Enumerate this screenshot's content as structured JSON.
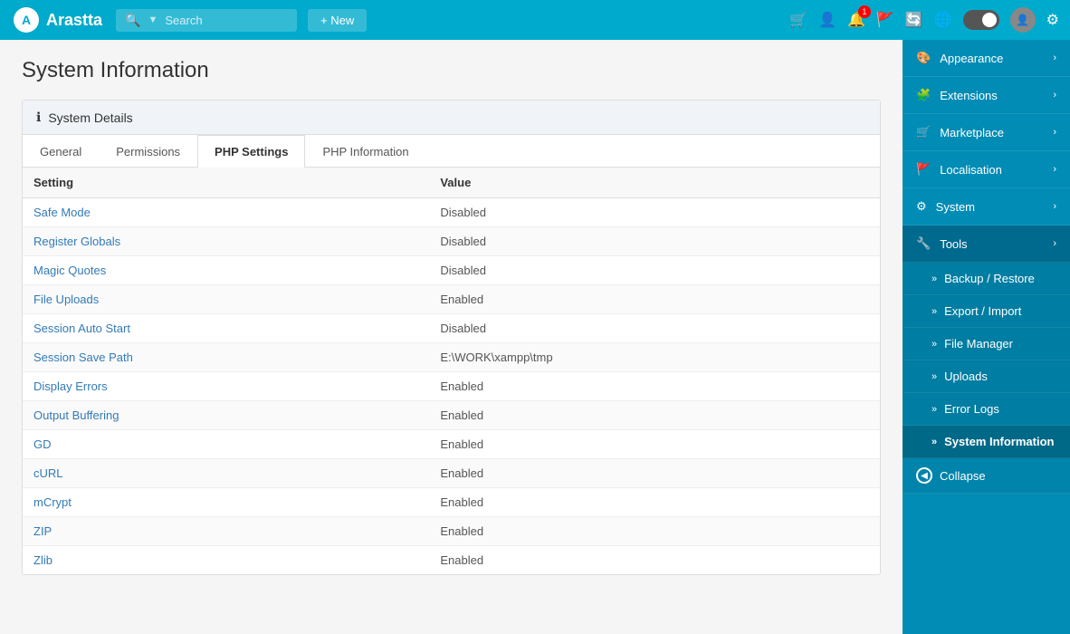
{
  "app": {
    "brand": "Arastta",
    "logo_letter": "A"
  },
  "navbar": {
    "search_placeholder": "Search",
    "new_label": "+ New",
    "notification_count": "1"
  },
  "page": {
    "title": "System Information"
  },
  "card": {
    "header": "System Details"
  },
  "tabs": [
    {
      "label": "General",
      "active": false
    },
    {
      "label": "Permissions",
      "active": false
    },
    {
      "label": "PHP Settings",
      "active": true
    },
    {
      "label": "PHP Information",
      "active": false
    }
  ],
  "table": {
    "col_setting": "Setting",
    "col_value": "Value",
    "rows": [
      {
        "setting": "Safe Mode",
        "value": "Disabled"
      },
      {
        "setting": "Register Globals",
        "value": "Disabled"
      },
      {
        "setting": "Magic Quotes",
        "value": "Disabled"
      },
      {
        "setting": "File Uploads",
        "value": "Enabled"
      },
      {
        "setting": "Session Auto Start",
        "value": "Disabled"
      },
      {
        "setting": "Session Save Path",
        "value": "E:\\WORK\\xampp\\tmp"
      },
      {
        "setting": "Display Errors",
        "value": "Enabled"
      },
      {
        "setting": "Output Buffering",
        "value": "Enabled"
      },
      {
        "setting": "GD",
        "value": "Enabled"
      },
      {
        "setting": "cURL",
        "value": "Enabled"
      },
      {
        "setting": "mCrypt",
        "value": "Enabled"
      },
      {
        "setting": "ZIP",
        "value": "Enabled"
      },
      {
        "setting": "Zlib",
        "value": "Enabled"
      }
    ]
  },
  "sidebar": {
    "items": [
      {
        "id": "appearance",
        "label": "Appearance",
        "icon": "🎨",
        "has_chevron": true
      },
      {
        "id": "extensions",
        "label": "Extensions",
        "icon": "🧩",
        "has_chevron": true
      },
      {
        "id": "marketplace",
        "label": "Marketplace",
        "icon": "🛒",
        "has_chevron": true
      },
      {
        "id": "localisation",
        "label": "Localisation",
        "icon": "🚩",
        "has_chevron": true
      },
      {
        "id": "system",
        "label": "System",
        "icon": "⚙",
        "has_chevron": true
      },
      {
        "id": "tools",
        "label": "Tools",
        "icon": "🔧",
        "active": true,
        "has_chevron": true
      }
    ],
    "sub_items": [
      {
        "id": "backup-restore",
        "label": "Backup / Restore"
      },
      {
        "id": "export-import",
        "label": "Export / Import"
      },
      {
        "id": "file-manager",
        "label": "File Manager"
      },
      {
        "id": "uploads",
        "label": "Uploads"
      },
      {
        "id": "error-logs",
        "label": "Error Logs"
      },
      {
        "id": "system-information",
        "label": "System Information",
        "active": true
      }
    ],
    "collapse_label": "Collapse"
  }
}
